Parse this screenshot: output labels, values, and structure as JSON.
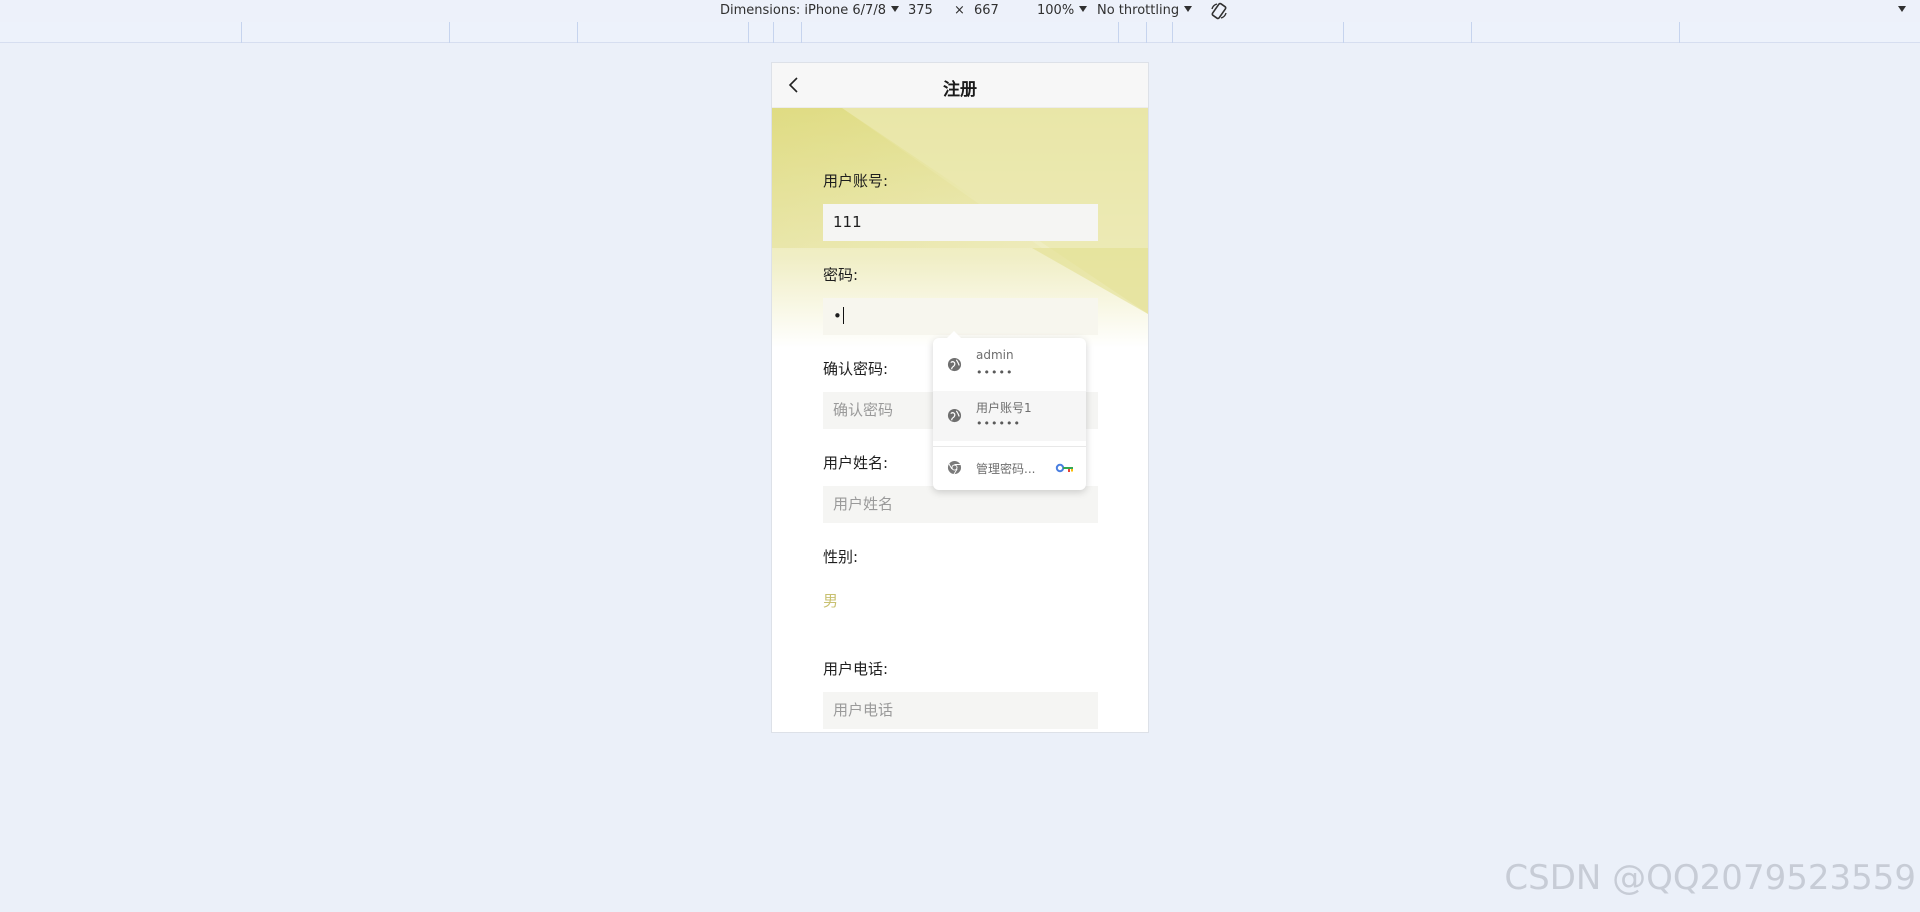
{
  "devtools": {
    "dimensions_label": "Dimensions: iPhone 6/7/8",
    "width": "375",
    "times": "×",
    "height": "667",
    "zoom": "100%",
    "throttling": "No throttling",
    "rotate_icon": "rotate-icon",
    "menu_icon": "chevron-down-icon"
  },
  "nav": {
    "title": "注册",
    "back_icon": "chevron-left-icon"
  },
  "form": {
    "username_label": "用户账号:",
    "username_value": "111",
    "password_label": "密码:",
    "password_value": "•",
    "confirm_label": "确认密码:",
    "confirm_placeholder": "确认密码",
    "realname_label": "用户姓名:",
    "realname_placeholder": "用户姓名",
    "gender_label": "性别:",
    "gender_value": "男",
    "phone_label": "用户电话:",
    "phone_placeholder": "用户电话"
  },
  "autofill": {
    "entries": [
      {
        "user": "admin",
        "password": "•••••"
      },
      {
        "user": "用户账号1",
        "password": "••••••"
      }
    ],
    "manage_label": "管理密码...",
    "entry_icon": "globe-icon",
    "manage_icon": "chrome-icon",
    "key_icon": "key-icon"
  },
  "colors": {
    "accent": "#e6e59f",
    "gender_text": "#c8c070",
    "page_bg": "#ebf0f9"
  },
  "watermark": "CSDN @QQ2079523559"
}
